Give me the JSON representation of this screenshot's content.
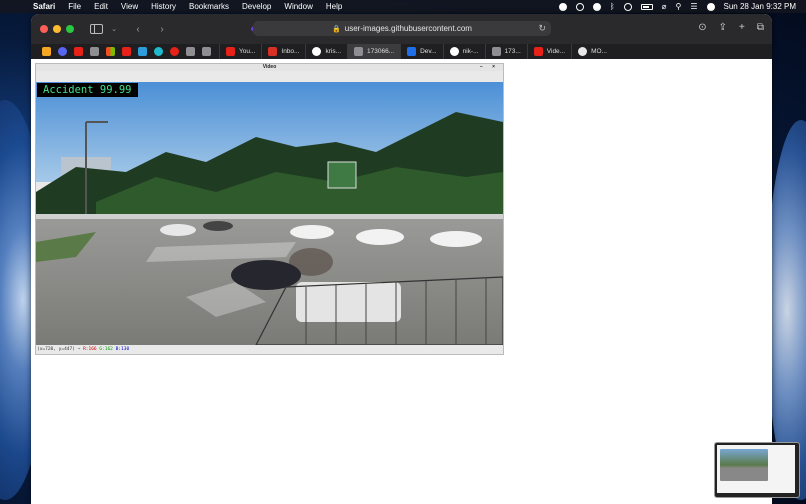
{
  "menubar": {
    "app": "Safari",
    "items": [
      "File",
      "Edit",
      "View",
      "History",
      "Bookmarks",
      "Develop",
      "Window",
      "Help"
    ],
    "clock": "Sun 28 Jan  9:32 PM"
  },
  "browser": {
    "url": "user-images.githubusercontent.com",
    "tabs": [
      {
        "label": "You...",
        "icon": "youtube-icon",
        "color": "#e62117"
      },
      {
        "label": "Inbo...",
        "icon": "gmail-icon",
        "color": "#d93025"
      },
      {
        "label": "kris...",
        "icon": "github-icon",
        "color": "#ffffff"
      },
      {
        "label": "173066...",
        "icon": "generic-page-icon",
        "color": "#8e8e93"
      },
      {
        "label": "Dev...",
        "icon": "devpost-icon",
        "color": "#1f6feb"
      },
      {
        "label": "nik-...",
        "icon": "github-icon",
        "color": "#ffffff"
      },
      {
        "label": "173...",
        "icon": "generic-page-icon",
        "color": "#8e8e93"
      },
      {
        "label": "Vide...",
        "icon": "youtube-icon",
        "color": "#e62117"
      },
      {
        "label": "MO...",
        "icon": "cloud-icon",
        "color": "#e8e8e8"
      }
    ],
    "pinned_colors": [
      "#f5a623",
      "#5865f2",
      "#e62117",
      "#8e8e93",
      "#f25022",
      "#e62117",
      "#2d9cdb",
      "#1fb8cd",
      "#e62117",
      "#8e8e93",
      "#8e8e93"
    ]
  },
  "video_window": {
    "title": "Video",
    "controls": "– ×",
    "detection_label": "Accident  99.99",
    "status_prefix": "(x=720, y=447) ~",
    "status_r": "R:166",
    "status_g": "G:162",
    "status_b": "B:130"
  },
  "colors": {
    "label_bg": "#000000",
    "label_text": "#3fe08a"
  }
}
